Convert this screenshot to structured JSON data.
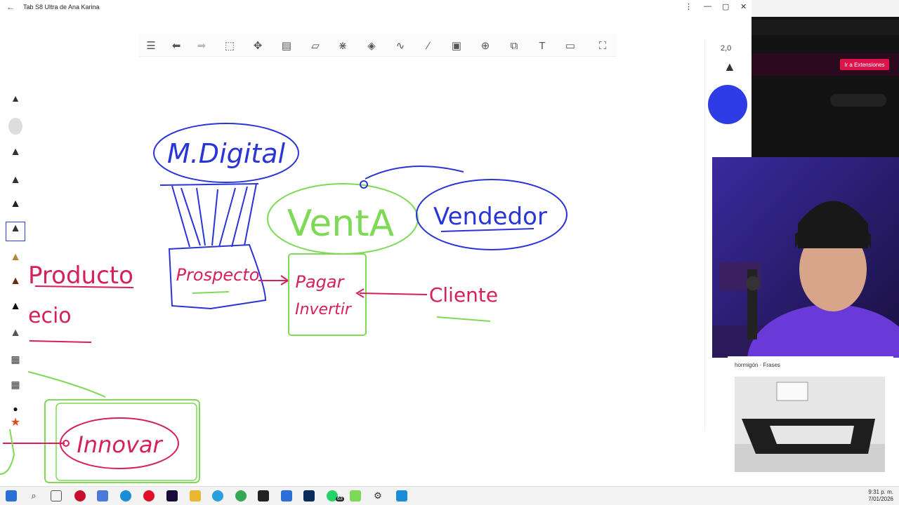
{
  "window": {
    "title": "Tab S8 Ultra de Ana Karina"
  },
  "pen_panel": {
    "size": "2,0",
    "color": "#2e3ce6"
  },
  "browser": {
    "extensions_button": "Ir a Extensiones"
  },
  "canvas": {
    "words": {
      "m_digital": "M.Digital",
      "venta": "VentA",
      "vendedor": "Vendedor",
      "prospecto": "Prospecto",
      "pagar": "Pagar",
      "invertir": "Invertir",
      "cliente": "Cliente",
      "producto": "Producto",
      "precio": "ecio",
      "innovar": "Innovar"
    },
    "colors": {
      "blue": "#2a35d6",
      "green": "#7ed957",
      "red": "#d6205a"
    }
  },
  "card": {
    "caption": "hormigón · Frases"
  },
  "taskbar": {
    "time": "9:31 p. m.",
    "date": "7/01/2026",
    "whatsapp_badge": "63"
  }
}
